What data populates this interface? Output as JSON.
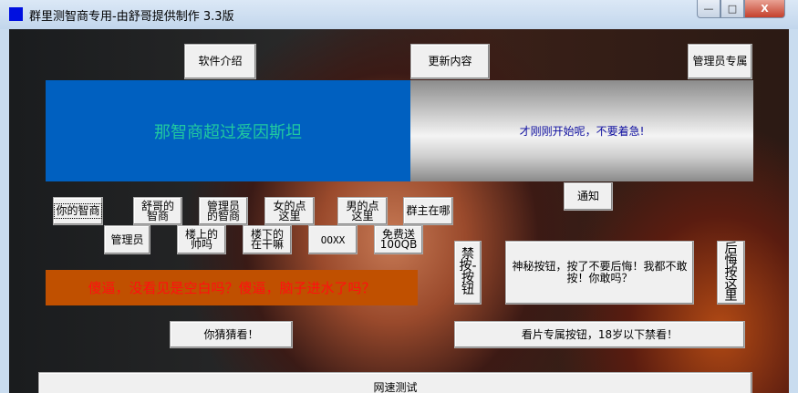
{
  "window": {
    "title": "群里测智商专用-由舒哥提供制作  3.3版",
    "minimize": "—",
    "maximize": "□",
    "close": "X"
  },
  "top_buttons": {
    "intro": "软件介绍",
    "update": "更新内容",
    "admin_only": "管理员专属"
  },
  "panels": {
    "blue_text": "那智商超过爱因斯坦",
    "gray_text": "才刚刚开始呢，不要着急!",
    "orange_text": "傻逼，没看见是空白吗？傻逼，脑子进水了吗？"
  },
  "notice": "通知",
  "row1": [
    "你的智商",
    "舒哥的智商",
    "管理员的智商",
    "女的点这里",
    "男的点这里",
    "群主在哪"
  ],
  "row2": [
    "管理员",
    "楼上的帅吗",
    "楼下的在干嘛",
    "OOXX",
    "免费送100QB"
  ],
  "side": {
    "forbidden": "禁按-按钮",
    "mystery": "神秘按钮，按了不要后悔！我都不敢按！你敢吗？",
    "regret": "后悔按这里"
  },
  "bottom": {
    "guess": "你猜猜看！",
    "movie": "看片专属按钮，18岁以下禁看！",
    "speed": "网速测试"
  },
  "colors": {
    "blue_panel": "#0060c0",
    "orange_panel": "#c05000",
    "orange_text": "#ff1010",
    "blue_text": "#20c8a0"
  }
}
